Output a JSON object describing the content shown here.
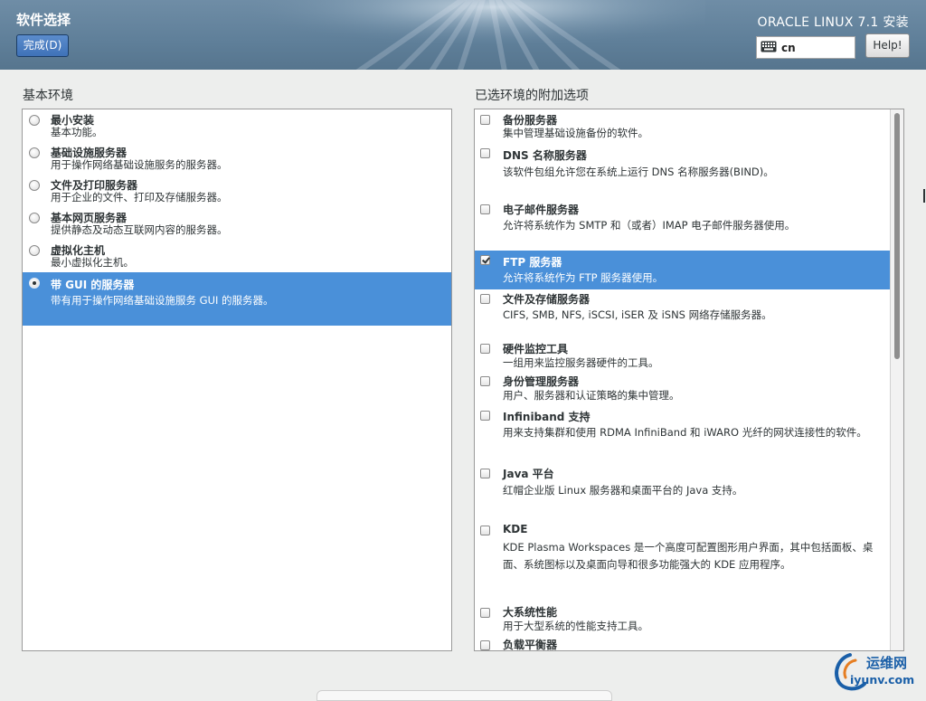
{
  "header": {
    "title": "软件选择",
    "done_button": "完成(D)",
    "product": "ORACLE LINUX 7.1 安装",
    "keyboard_layout": "cn",
    "help_button": "Help!"
  },
  "base_env": {
    "label": "基本环境",
    "selected_index": 5,
    "items": [
      {
        "name": "最小安装",
        "desc": "基本功能。"
      },
      {
        "name": "基础设施服务器",
        "desc": "用于操作网络基础设施服务的服务器。"
      },
      {
        "name": "文件及打印服务器",
        "desc": "用于企业的文件、打印及存储服务器。"
      },
      {
        "name": "基本网页服务器",
        "desc": "提供静态及动态互联网内容的服务器。"
      },
      {
        "name": "虚拟化主机",
        "desc": "最小虚拟化主机。"
      },
      {
        "name": "带 GUI 的服务器",
        "desc": "带有用于操作网络基础设施服务 GUI 的服务器。"
      }
    ]
  },
  "addons": {
    "label": "已选环境的附加选项",
    "items": [
      {
        "name": "备份服务器",
        "desc": "集中管理基础设施备份的软件。",
        "checked": false
      },
      {
        "name": "DNS 名称服务器",
        "desc": "该软件包组允许您在系统上运行 DNS 名称服务器(BIND)。",
        "checked": false
      },
      {
        "name": "电子邮件服务器",
        "desc": "允许将系统作为 SMTP 和（或者）IMAP 电子邮件服务器使用。",
        "checked": false
      },
      {
        "name": "FTP 服务器",
        "desc": "允许将系统作为 FTP 服务器使用。",
        "checked": true
      },
      {
        "name": "文件及存储服务器",
        "desc": "CIFS, SMB, NFS, iSCSI, iSER 及 iSNS 网络存储服务器。",
        "checked": false
      },
      {
        "name": "硬件监控工具",
        "desc": "一组用来监控服务器硬件的工具。",
        "checked": false
      },
      {
        "name": "身份管理服务器",
        "desc": "用户、服务器和认证策略的集中管理。",
        "checked": false
      },
      {
        "name": "Infiniband 支持",
        "desc": "用来支持集群和使用 RDMA InfiniBand 和 iWARO 光纤的网状连接性的软件。",
        "checked": false
      },
      {
        "name": "Java 平台",
        "desc": "红帽企业版 Linux 服务器和桌面平台的 Java 支持。",
        "checked": false
      },
      {
        "name": "KDE",
        "desc": " KDE Plasma Workspaces 是一个高度可配置图形用户界面，其中包括面板、桌面、系统图标以及桌面向导和很多功能强大的 KDE 应用程序。",
        "checked": false
      },
      {
        "name": "大系统性能",
        "desc": "用于大型系统的性能支持工具。",
        "checked": false
      },
      {
        "name": "负载平衡器",
        "desc": "",
        "checked": false
      }
    ]
  },
  "watermark": {
    "name": "运维网",
    "url": "iyunv.com"
  },
  "colors": {
    "header_bg": "#5f7f99",
    "selection": "#4a90d9",
    "done_button": "#3f72b8"
  }
}
